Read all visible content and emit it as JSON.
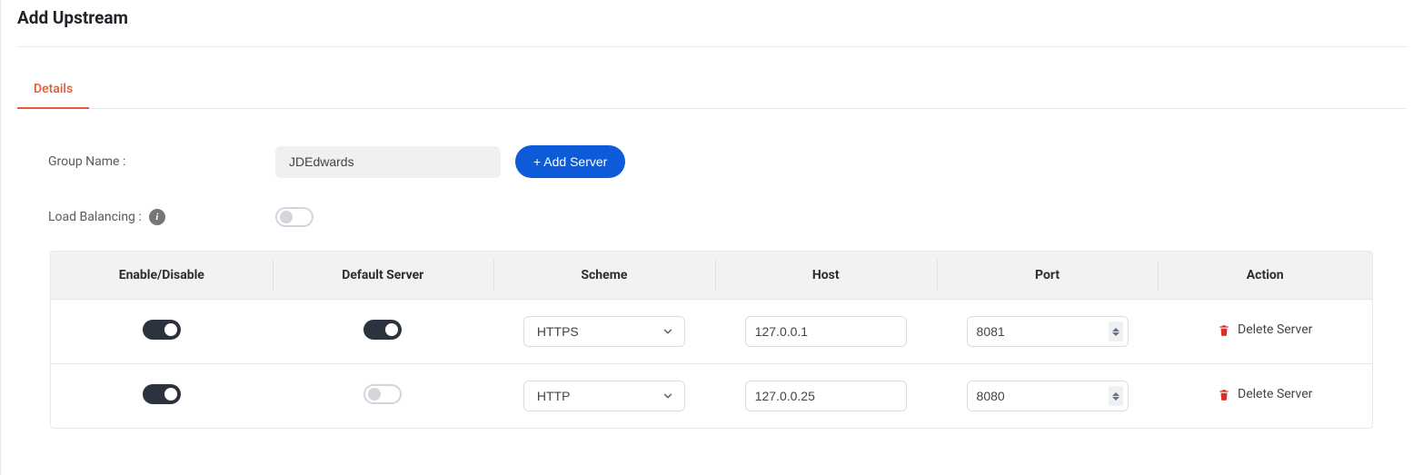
{
  "page": {
    "title": "Add Upstream"
  },
  "tabs": [
    {
      "label": "Details",
      "active": true
    }
  ],
  "form": {
    "group_name_label": "Group Name :",
    "group_name_value": "JDEdwards",
    "add_server_label": "+ Add Server",
    "load_balancing_label": "Load Balancing :",
    "load_balancing_on": false
  },
  "table": {
    "headers": {
      "enable": "Enable/Disable",
      "default_server": "Default Server",
      "scheme": "Scheme",
      "host": "Host",
      "port": "Port",
      "action": "Action"
    },
    "rows": [
      {
        "enabled": true,
        "default": true,
        "scheme": "HTTPS",
        "host": "127.0.0.1",
        "port": "8081",
        "action_label": "Delete Server"
      },
      {
        "enabled": true,
        "default": false,
        "scheme": "HTTP",
        "host": "127.0.0.25",
        "port": "8080",
        "action_label": "Delete Server"
      }
    ]
  }
}
